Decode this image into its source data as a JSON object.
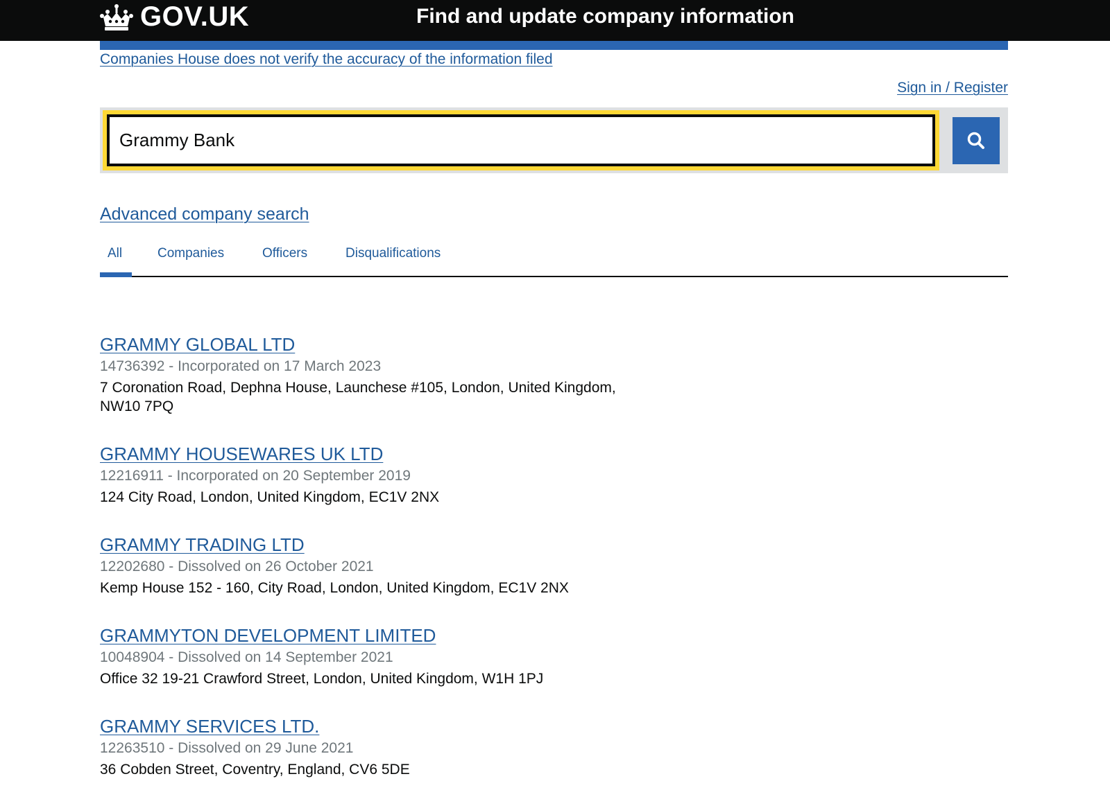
{
  "header": {
    "logo_text": "GOV.UK",
    "service_name": "Find and update company information"
  },
  "notice_link": "Companies House does not verify the accuracy of the information filed",
  "signin_link": "Sign in / Register",
  "search": {
    "value": "Grammy Bank"
  },
  "advanced_search_link": "Advanced company search",
  "tabs": [
    {
      "label": "All",
      "active": true
    },
    {
      "label": "Companies",
      "active": false
    },
    {
      "label": "Officers",
      "active": false
    },
    {
      "label": "Disqualifications",
      "active": false
    }
  ],
  "results": [
    {
      "name": "GRAMMY GLOBAL LTD",
      "meta": "14736392 - Incorporated on 17 March 2023",
      "address_line1": "7 Coronation Road, Dephna House, Launchese #105, London, United Kingdom,",
      "address_line2": "NW10 7PQ"
    },
    {
      "name": "GRAMMY HOUSEWARES UK LTD",
      "meta": "12216911 - Incorporated on 20 September 2019",
      "address_line1": "124 City Road, London, United Kingdom, EC1V 2NX"
    },
    {
      "name": "GRAMMY TRADING LTD",
      "meta": "12202680 - Dissolved on 26 October 2021",
      "address_line1": "Kemp House 152 - 160, City Road, London, United Kingdom, EC1V 2NX"
    },
    {
      "name": "GRAMMYTON DEVELOPMENT LIMITED",
      "meta": "10048904 - Dissolved on 14 September 2021",
      "address_line1": "Office 32 19-21 Crawford Street, London, United Kingdom, W1H 1PJ"
    },
    {
      "name": "GRAMMY SERVICES LTD.",
      "meta": "12263510 - Dissolved on 29 June 2021",
      "address_line1": "36 Cobden Street, Coventry, England, CV6 5DE"
    }
  ],
  "colors": {
    "header_bg": "#0b0c0c",
    "brand_blue": "#2b66b2",
    "link": "#1f5a9a",
    "focus_yellow": "#fdd835",
    "meta_grey": "#6f777b"
  },
  "icons": {
    "logo": "crown-icon",
    "search_button": "search-icon"
  }
}
